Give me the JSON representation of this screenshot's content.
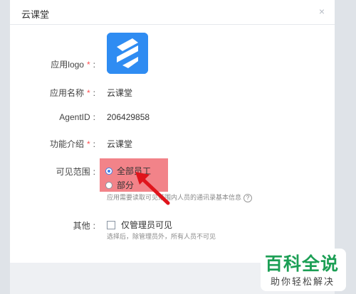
{
  "dialog": {
    "title": "云课堂",
    "close_glyph": "×"
  },
  "fields": {
    "logo_label": "应用logo",
    "name_label": "应用名称",
    "name_value": "云课堂",
    "agentid_label": "AgentID",
    "agentid_value": "206429858",
    "intro_label": "功能介绍",
    "intro_value": "云课堂",
    "scope_label": "可见范围",
    "scope_options": [
      "全部员工",
      "部分"
    ],
    "scope_selected": "全部员工",
    "scope_hint": "应用需要读取可见范围内人员的通讯录基本信息",
    "other_label": "其他",
    "admin_only_label": "仅管理员可见",
    "admin_only_checked": false,
    "other_hint": "选择后，除管理员外，所有人员不可见",
    "required_mark": "*",
    "colon": ":"
  },
  "watermark": {
    "title": "百科全说",
    "subtitle": "助你轻松解决"
  },
  "colors": {
    "logo_bg": "#2f8cf2",
    "highlight": "#ee6068",
    "arrow": "#e0141c",
    "radio_checked": "#3a80f0",
    "watermark_green": "#1c9f55"
  }
}
